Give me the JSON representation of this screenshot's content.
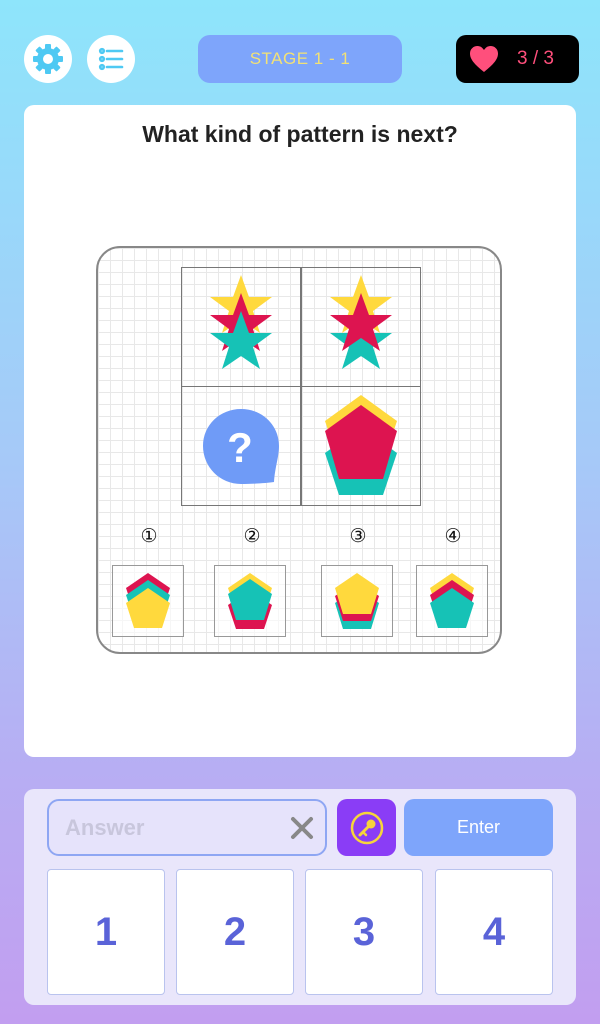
{
  "header": {
    "stage_label": "STAGE 1 - 1",
    "lives_text": "3 / 3",
    "settings_icon": "gear-icon",
    "menu_icon": "list-icon",
    "lives_icon": "heart-icon"
  },
  "puzzle": {
    "question": "What kind of pattern is next?",
    "unknown_symbol": "?",
    "options": [
      "①",
      "②",
      "③",
      "④"
    ]
  },
  "answer_panel": {
    "placeholder": "Answer",
    "value": "",
    "clear_icon": "close-icon",
    "hint_icon": "key-icon",
    "enter_label": "Enter",
    "keys": [
      "1",
      "2",
      "3",
      "4"
    ]
  },
  "colors": {
    "yellow": "#ffd93d",
    "crimson": "#dd1450",
    "teal": "#16c2b6",
    "accent_blue": "#7ea5fb",
    "hint_purple": "#8a3df6",
    "heart_pink": "#ff4f7c"
  }
}
